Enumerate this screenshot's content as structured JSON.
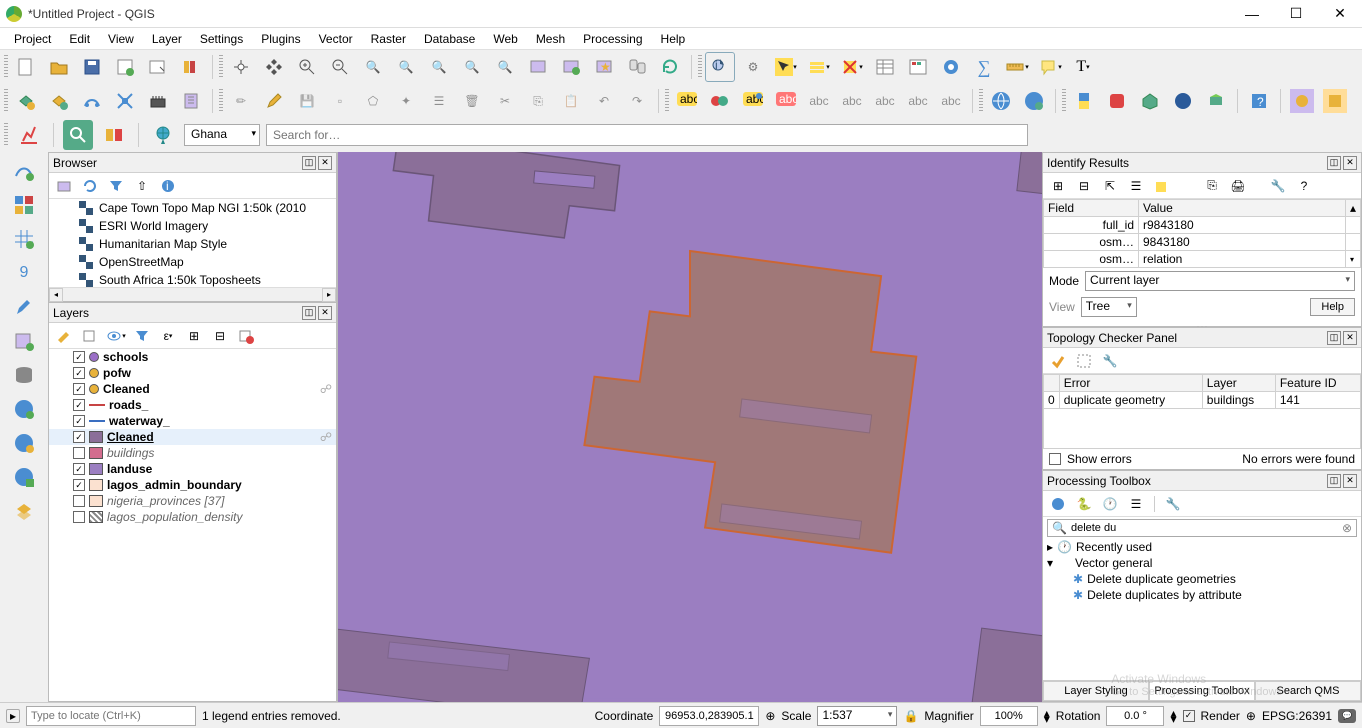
{
  "window": {
    "title": "*Untitled Project - QGIS"
  },
  "menu": [
    "Project",
    "Edit",
    "View",
    "Layer",
    "Settings",
    "Plugins",
    "Vector",
    "Raster",
    "Database",
    "Web",
    "Mesh",
    "Processing",
    "Help"
  ],
  "search": {
    "locate_label": "Ghana",
    "placeholder": "Search for…"
  },
  "browser": {
    "title": "Browser",
    "items": [
      "Cape Town Topo Map NGI 1:50k (2010",
      "ESRI World Imagery",
      "Humanitarian Map Style",
      "OpenStreetMap",
      "South Africa 1:50k Toposheets"
    ]
  },
  "layers": {
    "title": "Layers",
    "items": [
      {
        "checked": true,
        "swatch": "#9b6fc7",
        "shape": "dot",
        "label": "schools",
        "bold": true
      },
      {
        "checked": true,
        "swatch": "#e8b23a",
        "shape": "dot",
        "label": "pofw",
        "bold": true
      },
      {
        "checked": true,
        "swatch": "#e8b23a",
        "shape": "dot",
        "label": "Cleaned",
        "bold": true,
        "badge": true
      },
      {
        "checked": true,
        "swatch": "#c74444",
        "shape": "line",
        "label": "roads_",
        "bold": true
      },
      {
        "checked": true,
        "swatch": "#3a6ec1",
        "shape": "line",
        "label": "waterway_",
        "bold": true
      },
      {
        "checked": true,
        "swatch": "#8b6f99",
        "shape": "square",
        "label": "Cleaned",
        "bold": true,
        "underline": true,
        "selected": true,
        "badge": true
      },
      {
        "checked": false,
        "swatch": "#d36c8e",
        "shape": "square",
        "label": "buildings",
        "italic": true
      },
      {
        "checked": true,
        "swatch": "#9b7ec1",
        "shape": "square",
        "label": "landuse",
        "bold": true
      },
      {
        "checked": true,
        "swatch": "#fbe1d0",
        "shape": "square",
        "label": "lagos_admin_boundary",
        "bold": true
      },
      {
        "checked": false,
        "swatch": "#fbe1d0",
        "shape": "square",
        "label": "nigeria_provinces [37]",
        "italic": true
      },
      {
        "checked": false,
        "swatch": "#f0f0f0",
        "shape": "grid",
        "label": "lagos_population_density",
        "italic": true
      }
    ]
  },
  "identify": {
    "title": "Identify Results",
    "field": "Field",
    "value": "Value",
    "rows": [
      {
        "k": "full_id",
        "v": "r9843180"
      },
      {
        "k": "osm…",
        "v": "9843180"
      },
      {
        "k": "osm…",
        "v": "relation"
      }
    ],
    "mode_label": "Mode",
    "mode_value": "Current layer",
    "view_label": "View",
    "view_value": "Tree",
    "help": "Help"
  },
  "topology": {
    "title": "Topology Checker Panel",
    "cols": [
      "Error",
      "Layer",
      "Feature ID"
    ],
    "row": {
      "idx": "0",
      "error": "duplicate geometry",
      "layer": "buildings",
      "fid": "141"
    },
    "show_errors": "Show errors",
    "no_errors": "No errors were found"
  },
  "processing": {
    "title": "Processing Toolbox",
    "search": "delete du",
    "recent": "Recently used",
    "group": "Vector general",
    "algo1": "Delete duplicate geometries",
    "algo2": "Delete duplicates by attribute",
    "tabs": [
      "Layer Styling",
      "Processing Toolbox",
      "Search QMS"
    ]
  },
  "status": {
    "locate_placeholder": "Type to locate (Ctrl+K)",
    "message": "1 legend entries removed.",
    "coord_label": "Coordinate",
    "coord_value": "96953.0,283905.1",
    "scale_label": "Scale",
    "scale_value": "1:537",
    "mag_label": "Magnifier",
    "mag_value": "100%",
    "rot_label": "Rotation",
    "rot_value": "0.0 °",
    "render": "Render",
    "crs": "EPSG:26391"
  },
  "watermark": {
    "line1": "Activate Windows",
    "line2": "Go to Settings to activate Windows"
  }
}
